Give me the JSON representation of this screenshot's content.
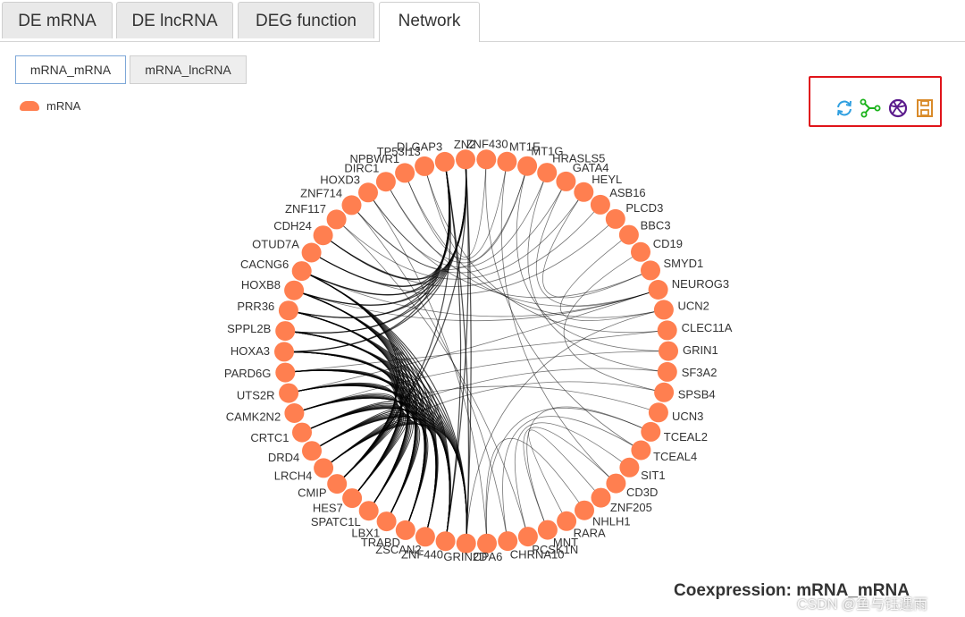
{
  "tabs": [
    {
      "label": "DE mRNA",
      "active": false
    },
    {
      "label": "DE lncRNA",
      "active": false
    },
    {
      "label": "DEG function",
      "active": false
    },
    {
      "label": "Network",
      "active": true
    }
  ],
  "subtabs": [
    {
      "label": "mRNA_mRNA",
      "active": true
    },
    {
      "label": "mRNA_lncRNA",
      "active": false
    }
  ],
  "legend": {
    "label": "mRNA",
    "color": "#ff7f50"
  },
  "toolbox": {
    "icons": [
      "refresh-icon",
      "graph-layout-icon",
      "chord-view-icon",
      "save-image-icon"
    ],
    "colors": [
      "#2f9fe0",
      "#1bb31b",
      "#5a1a8c",
      "#d98a29"
    ]
  },
  "chart_title": "Coexpression: mRNA_mRNA",
  "watermark": "CSDN @鱼与钰遇雨",
  "chart_data": {
    "type": "circular-network",
    "node_color": "#ff7f50",
    "edge_color": "#000000",
    "nodes": [
      "ZNF430",
      "MT1E",
      "MT1G",
      "HRASLS5",
      "GATA4",
      "HEYL",
      "ASB16",
      "PLCD3",
      "BBC3",
      "CD19",
      "SMYD1",
      "NEUROG3",
      "UCN2",
      "CLEC11A",
      "GRIN1",
      "SF3A2",
      "SPSB4",
      "UCN3",
      "TCEAL2",
      "TCEAL4",
      "SIT1",
      "CD3D",
      "ZNF205",
      "NHLH1",
      "RARA",
      "MNT",
      "PCSK1N",
      "CHRNA10",
      "CPA6",
      "GRIN2D",
      "ZNF440",
      "ZSCAN2",
      "TRABD",
      "LBX1",
      "SPATC1L",
      "HES7",
      "CMIP",
      "LRCH4",
      "DRD4",
      "CRTC1",
      "CAMK2N2",
      "UTS2R",
      "PARD6G",
      "HOXA3",
      "SPPL2B",
      "PRR36",
      "HOXB8",
      "CACNG6",
      "OTUD7A",
      "CDH24",
      "ZNF117",
      "ZNF714",
      "HOXD3",
      "DIRC1",
      "NPBWR1",
      "TP53I13",
      "DLGAP3",
      "ZN2"
    ],
    "node_count": 58
  }
}
